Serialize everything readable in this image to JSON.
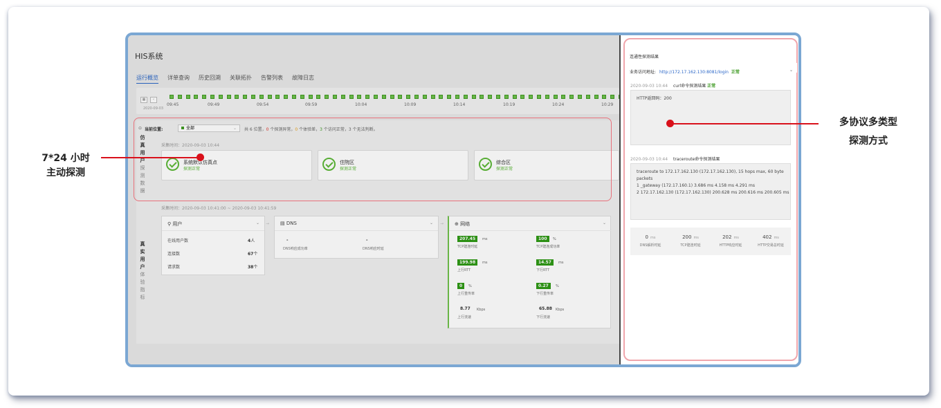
{
  "app": {
    "title": "HIS系统",
    "tabs": [
      "运行概览",
      "详单查询",
      "历史回溯",
      "关联拓扑",
      "告警列表",
      "故障日志"
    ],
    "timeline": {
      "date": "2020-09-03",
      "times": [
        "09:45",
        "09:49",
        "09:54",
        "09:59",
        "10:04",
        "10:09",
        "10:14",
        "10:19",
        "10:24",
        "10:29"
      ]
    },
    "sim_section": {
      "label": [
        "仿",
        "真",
        "用",
        "户",
        "探",
        "测",
        "数",
        "据"
      ],
      "location_label": "当前位置:",
      "location_value": "全部",
      "summary_prefix": "共 6 位置，",
      "summary_abnormal_count": "0",
      "summary_abnormal_text": " 个探测异常，",
      "summary_poor_count": "0",
      "summary_poor_text": " 个体验差，",
      "summary_ok_count": "3",
      "summary_rest": " 个访问正常，3 个无法判断。",
      "time": "采集时间：2020-09-03 10:44",
      "locations": [
        {
          "name": "系统默认仿真点",
          "status": "探测正常"
        },
        {
          "name": "住院区",
          "status": "探测正常"
        },
        {
          "name": "综合区",
          "status": "探测正常"
        }
      ]
    },
    "real_section": {
      "label": [
        "真",
        "实",
        "用",
        "户",
        "体",
        "验",
        "指",
        "标"
      ],
      "time": "采集时间：2020-09-03 10:41:00 ~ 2020-09-03 10:41:59",
      "user_panel": {
        "title": "用户",
        "rows": [
          {
            "label": "在线用户数",
            "value": "4",
            "unit": "人"
          },
          {
            "label": "连接数",
            "value": "67",
            "unit": "个"
          },
          {
            "label": "请求数",
            "value": "38",
            "unit": "个"
          }
        ]
      },
      "dns_panel": {
        "title": "DNS",
        "metrics": [
          {
            "value": "-",
            "label": "DNS响应成功率"
          },
          {
            "value": "-",
            "label": "DNS响应时延"
          }
        ]
      },
      "net_panel": {
        "title": "网络",
        "metrics": [
          {
            "value": "207.45",
            "unit": "ms",
            "label": "TCP建连时延"
          },
          {
            "value": "100",
            "unit": "%",
            "label": "TCP建连成功率"
          },
          {
            "value": "199.98",
            "unit": "ms",
            "label": "上行RTT"
          },
          {
            "value": "14.57",
            "unit": "ms",
            "label": "下行RTT"
          },
          {
            "value": "0",
            "unit": "%",
            "label": "上行重传率"
          },
          {
            "value": "0.27",
            "unit": "%",
            "label": "下行重传率"
          },
          {
            "value": "8.77",
            "unit": "Kbps",
            "label": "上行流速"
          },
          {
            "value": "65.88",
            "unit": "Kbps",
            "label": "下行流速"
          }
        ]
      }
    }
  },
  "side_panel": {
    "title": "连通性探测结果",
    "service_label": "业务访问地址:",
    "service_url": "http://172.17.162.130:8081/login",
    "service_status": "正常",
    "curl": {
      "time": "2020-09-03 10:44",
      "label": "curl命令探测结果",
      "status": "正常",
      "output": "HTTP返回码：200"
    },
    "traceroute": {
      "time": "2020-09-03 10:44",
      "label": "traceroute命令探测结果",
      "lines": [
        "traceroute to 172.17.162.130 (172.17.162.130), 15 hops max, 60 byte",
        "packets",
        " 1  _gateway (172.17.160.1)  3.686 ms  4.158 ms  4.291 ms",
        " 2  172.17.162.130 (172.17.162.130)  200.628 ms  200.616 ms  200.605 ms"
      ]
    },
    "stats": [
      {
        "value": "0",
        "unit": "ms",
        "label": "DNS解析时延"
      },
      {
        "value": "200",
        "unit": "ms",
        "label": "TCP建连时延"
      },
      {
        "value": "202",
        "unit": "ms",
        "label": "HTTP响应时延"
      },
      {
        "value": "402",
        "unit": "ms",
        "label": "HTTP交易总时延"
      }
    ]
  },
  "annotations": {
    "left": [
      "7*24 小时",
      "主动探测"
    ],
    "right": [
      "多协议多类型",
      "探测方式"
    ]
  },
  "colors": {
    "highlight": "#d9101a",
    "frame": "#7ba7d3",
    "status_ok": "#3f9a23",
    "link": "#2a66c7"
  }
}
